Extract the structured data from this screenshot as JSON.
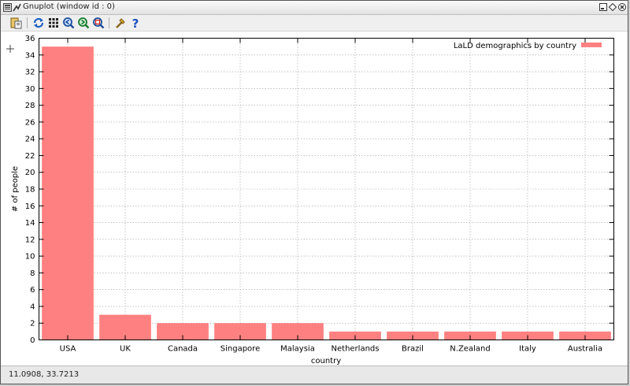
{
  "window": {
    "title": "Gnuplot (window id : 0)"
  },
  "toolbar": {
    "buttons": [
      {
        "icon": "copy-clipboard-icon"
      },
      {
        "icon": "replot-icon"
      },
      {
        "icon": "grid-icon"
      },
      {
        "icon": "zoom-previous-icon"
      },
      {
        "icon": "zoom-next-icon"
      },
      {
        "icon": "autoscale-icon"
      },
      {
        "icon": "config-icon"
      },
      {
        "icon": "help-icon"
      }
    ]
  },
  "status": {
    "coords": "11.0908,  33.7213"
  },
  "chart_data": {
    "type": "bar",
    "categories": [
      "USA",
      "UK",
      "Canada",
      "Singapore",
      "Malaysia",
      "Netherlands",
      "Brazil",
      "N.Zealand",
      "Italy",
      "Australia"
    ],
    "series": [
      {
        "name": "LaLD demographics by country",
        "values": [
          35,
          3,
          2,
          2,
          2,
          1,
          1,
          1,
          1,
          1
        ]
      }
    ],
    "xlabel": "country",
    "ylabel": "# of people",
    "ylim": [
      0,
      36
    ],
    "yticks": [
      0,
      2,
      4,
      6,
      8,
      10,
      12,
      14,
      16,
      18,
      20,
      22,
      24,
      26,
      28,
      30,
      32,
      34,
      36
    ],
    "grid": true,
    "legend_position": "top-right",
    "bar_color": "#ff8080"
  }
}
